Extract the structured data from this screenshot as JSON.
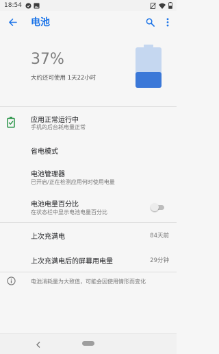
{
  "status_bar": {
    "time": "18:54"
  },
  "app_bar": {
    "title": "电池"
  },
  "header": {
    "percent": "37%",
    "level": 0.37,
    "estimate": "大约还可使用 1天22小时"
  },
  "colors": {
    "accent": "#1a73e8",
    "battery_fill": "#3b78d8",
    "battery_empty": "#c5d7f0",
    "status_ok": "#1e8e3e"
  },
  "list": {
    "app_status": {
      "title": "应用正常运行中",
      "subtitle": "手机的后台耗电量正常",
      "icon": "battery-check-icon"
    },
    "battery_saver": {
      "title": "省电模式"
    },
    "battery_manager": {
      "title": "电池管理器",
      "subtitle": "已开启/正在检测应用何时使用电量"
    },
    "battery_percentage": {
      "title": "电池电量百分比",
      "subtitle": "在状态栏中显示电池电量百分比",
      "enabled": false
    },
    "last_full_charge": {
      "title": "上次充满电",
      "value": "84天前"
    },
    "screen_usage": {
      "title": "上次充满电后的屏幕用电量",
      "value": "29分钟"
    },
    "info": {
      "text": "电池消耗量为大致值，可能会因使用情形而变化",
      "icon": "info-icon"
    }
  }
}
